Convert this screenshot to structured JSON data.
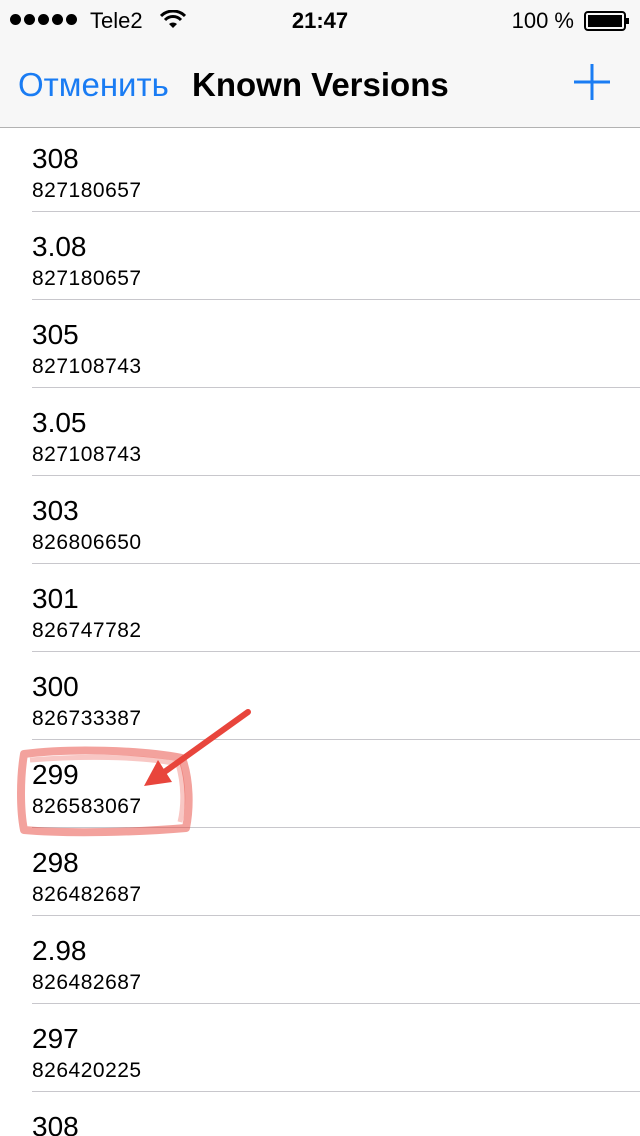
{
  "status_bar": {
    "carrier": "Tele2",
    "time": "21:47",
    "battery": "100 %"
  },
  "nav": {
    "cancel_label": "Отменить",
    "title": "Known Versions",
    "add_icon": "plus-icon"
  },
  "versions": [
    {
      "version": "308",
      "id": "827180657"
    },
    {
      "version": "3.08",
      "id": "827180657"
    },
    {
      "version": "305",
      "id": "827108743"
    },
    {
      "version": "3.05",
      "id": "827108743"
    },
    {
      "version": "303",
      "id": "826806650"
    },
    {
      "version": "301",
      "id": "826747782"
    },
    {
      "version": "300",
      "id": "826733387"
    },
    {
      "version": "299",
      "id": "826583067"
    },
    {
      "version": "298",
      "id": "826482687"
    },
    {
      "version": "2.98",
      "id": "826482687"
    },
    {
      "version": "297",
      "id": "826420225"
    },
    {
      "version": "308",
      "id": ""
    }
  ],
  "annotation": {
    "highlighted_version": "299",
    "color": "#e8453c"
  },
  "colors": {
    "accent": "#1a7cf3",
    "bar_background": "#f7f7f7",
    "separator": "#c8c7cc"
  }
}
